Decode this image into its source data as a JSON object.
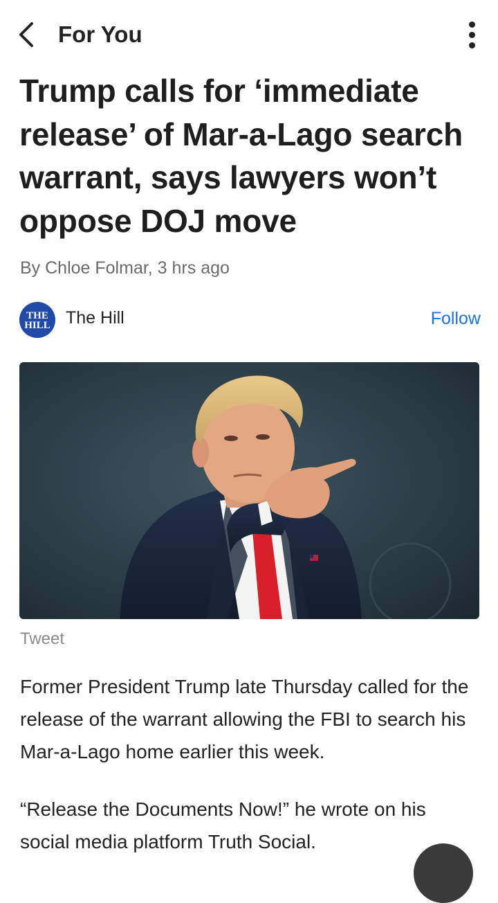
{
  "topbar": {
    "back_icon": "chevron-left-icon",
    "title": "For You",
    "more_icon": "more-vertical-icon"
  },
  "article": {
    "headline": "Trump calls for ‘immediate release’ of Mar-a-Lago search warrant, says lawyers won’t oppose DOJ move",
    "byline": "By Chloe Folmar, 3 hrs ago",
    "source": {
      "name": "The Hill",
      "logo_text_line1": "THE",
      "logo_text_line2": "HILL",
      "logo_color": "#1f4aa8",
      "follow_label": "Follow",
      "follow_color": "#1a73d9"
    },
    "image_caption": "Tweet",
    "paragraphs": [
      "Former President Trump late Thursday called for the release of the warrant allowing the FBI to search his Mar-a-Lago home earlier this week.",
      "“Release the Documents Now!” he wrote on his social media platform Truth Social."
    ]
  },
  "floating_button": {
    "icon": "floating-action-icon"
  }
}
